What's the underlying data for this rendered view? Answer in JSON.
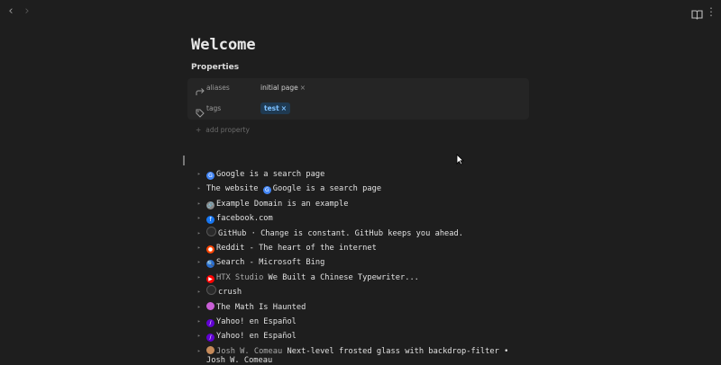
{
  "nav": {
    "back": "‹",
    "forward": "›"
  },
  "title": "Welcome",
  "properties": {
    "heading": "Properties",
    "aliases": {
      "key": "aliases",
      "value": "initial page",
      "remove": "×"
    },
    "tags": {
      "key": "tags",
      "value": "test",
      "remove": "×"
    },
    "add": {
      "plus": "+",
      "label": "add property"
    }
  },
  "items": [
    {
      "pre": "",
      "source": "",
      "text": "Google is a search page",
      "icon": "google-icon",
      "color": "#4285f4"
    },
    {
      "pre": "The website ",
      "source": "",
      "text": "Google is a search page",
      "icon": "google-icon",
      "color": "#4285f4"
    },
    {
      "pre": "",
      "source": "",
      "text": "Example Domain is an example",
      "icon": "link-icon",
      "color": "#888888"
    },
    {
      "pre": "",
      "source": "",
      "text": "facebook.com",
      "icon": "facebook-icon",
      "color": "#1877f2"
    },
    {
      "pre": "",
      "source": "",
      "text": "GitHub · Change is constant. GitHub keeps you ahead.",
      "icon": "github-icon",
      "color": "#2a2a2a"
    },
    {
      "pre": "",
      "source": "",
      "text": "Reddit - The heart of the internet",
      "icon": "reddit-icon",
      "color": "#ff4500"
    },
    {
      "pre": "",
      "source": "",
      "text": "Search - Microsoft Bing",
      "icon": "search-icon",
      "color": "#2a6fd1"
    },
    {
      "pre": "",
      "source": "HTX Studio ",
      "text": "We Built a Chinese Typewriter...",
      "icon": "youtube-icon",
      "color": "#ff0000"
    },
    {
      "pre": "",
      "source": "",
      "text": "crush",
      "icon": "globe-icon",
      "color": "#2a2a2a"
    },
    {
      "pre": "",
      "source": "",
      "text": "The Math Is Haunted",
      "icon": "substack-icon",
      "color": "#c95fd6"
    },
    {
      "pre": "",
      "source": "",
      "text": "Yahoo! en Español",
      "icon": "yahoo-icon",
      "color": "#6001d2"
    },
    {
      "pre": "",
      "source": "",
      "text": "Yahoo! en Español",
      "icon": "yahoo-icon",
      "color": "#6001d2"
    },
    {
      "pre": "",
      "source": "Josh W. Comeau ",
      "text": "Next-level frosted glass with backdrop-filter •",
      "icon": "avatar-icon",
      "color": "#c58a5a"
    }
  ],
  "overflow_text": "Josh W. Comeau",
  "colors": {
    "background": "#1e1e1e",
    "panel": "#252525",
    "tag_bg": "#1f3a52",
    "tag_fg": "#7cc0ff"
  }
}
